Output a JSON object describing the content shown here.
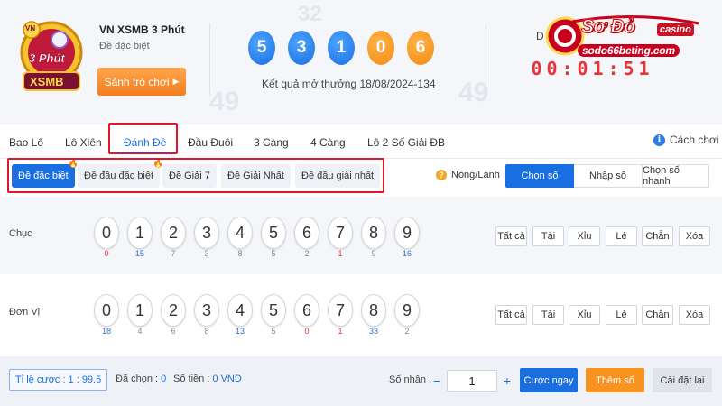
{
  "header": {
    "game_title": "VN XSMB 3 Phút",
    "game_subtitle": "Đề đặc biệt",
    "lobby_button": "Sảnh trò chơi",
    "logo": {
      "line1": "3 Phút",
      "line2": "XSMB",
      "badge": "VN"
    },
    "result_numbers": [
      "5",
      "3",
      "1",
      "0",
      "6"
    ],
    "result_text": "Kết quả mở thưởng 18/08/2024-134",
    "countdown_label": "D",
    "countdown_digits": [
      "0",
      "0",
      ":",
      "0",
      "1",
      ":",
      "5",
      "1"
    ],
    "brand": {
      "name": "Sơ Đỏ",
      "casino": "casino",
      "url": "sodo66beting.com"
    },
    "deco_text": [
      "49",
      "32",
      "49"
    ]
  },
  "tabs": {
    "items": [
      "Bao Lô",
      "Lô Xiên",
      "Đánh Đề",
      "Đầu Đuôi",
      "3 Càng",
      "4 Càng",
      "Lô 2 Số Giải ĐB"
    ],
    "active": "Đánh Đề",
    "howto": "Cách chơi"
  },
  "subtabs": {
    "items": [
      "Đề đặc biệt",
      "Đề đầu đặc biệt",
      "Đề Giải 7",
      "Đề Giải Nhất",
      "Đề đầu giải nhất"
    ],
    "active": "Đề đặc biệt",
    "hot_icon": "fire-icon",
    "hot_cold": "Nóng/Lạnh",
    "modes": [
      "Chọn số",
      "Nhập số",
      "Chọn số nhanh"
    ],
    "active_mode": "Chọn số"
  },
  "rows": [
    {
      "label": "Chục",
      "numbers": [
        "0",
        "1",
        "2",
        "3",
        "4",
        "5",
        "6",
        "7",
        "8",
        "9"
      ],
      "counts": [
        "0",
        "15",
        "7",
        "3",
        "8",
        "5",
        "2",
        "1",
        "9",
        "16"
      ],
      "count_colors": [
        "#e5343a",
        "#2d6fd0",
        "#888888",
        "#888888",
        "#888888",
        "#888888",
        "#888888",
        "#e5343a",
        "#888888",
        "#2d6fd0"
      ]
    },
    {
      "label": "Đơn Vị",
      "numbers": [
        "0",
        "1",
        "2",
        "3",
        "4",
        "5",
        "6",
        "7",
        "8",
        "9"
      ],
      "counts": [
        "18",
        "4",
        "6",
        "8",
        "13",
        "5",
        "0",
        "1",
        "33",
        "2"
      ],
      "count_colors": [
        "#2d6fd0",
        "#888888",
        "#888888",
        "#888888",
        "#2d6fd0",
        "#888888",
        "#e5343a",
        "#e5343a",
        "#2d6fd0",
        "#888888"
      ]
    }
  ],
  "quick_buttons": [
    "Tất cả",
    "Tài",
    "Xỉu",
    "Lẻ",
    "Chẵn",
    "Xóa"
  ],
  "footer": {
    "odds_label": "Tỉ lệ cược :",
    "odds_value": "1 : 99.5",
    "selected_label": "Đã chọn :",
    "selected_value": "0",
    "amount_label": "Số tiền :",
    "amount_value": "0 VND",
    "multiplier_label": "Số nhân :",
    "minus": "−",
    "multiplier_value": "1",
    "plus": "+",
    "bet_now": "Cược ngay",
    "add_number": "Thêm số",
    "reset": "Cài đặt lại"
  },
  "colors": {
    "accent": "#1a6fe0",
    "orange": "#f7931e",
    "highlight_border": "#e0162b",
    "panel_bg": "#f4f6f9"
  }
}
